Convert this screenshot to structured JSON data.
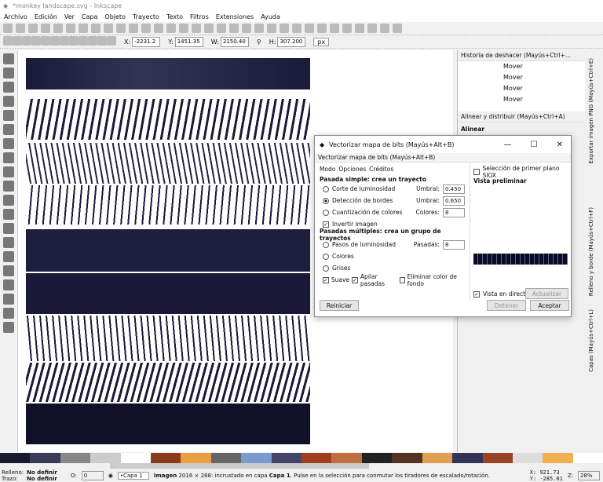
{
  "window": {
    "title": "*monkey landscape.svg - Inkscape"
  },
  "menu": [
    "Archivo",
    "Edición",
    "Ver",
    "Capa",
    "Objeto",
    "Trayecto",
    "Texto",
    "Filtros",
    "Extensiones",
    "Ayuda"
  ],
  "coords": {
    "x_label": "X:",
    "x": "-2231.2",
    "y_label": "Y:",
    "y": "1451.35",
    "w_label": "W:",
    "w": "2150.40",
    "h_label": "H:",
    "h": "307.200",
    "unit": "px"
  },
  "history": {
    "title": "Historia de deshacer (Mayús+Ctrl+...",
    "items": [
      "Mover",
      "Mover",
      "Mover",
      "Mover"
    ]
  },
  "align": {
    "title": "Alinear y distribuir (Mayús+Ctrl+A)",
    "section": "Alinear"
  },
  "vtabs": [
    "Exportar imagen PNG (Mayús+Ctrl+E)",
    "Relleno y borde (Mayús+Ctrl+F)",
    "Capas (Mayús+Ctrl+L)"
  ],
  "dialog": {
    "title": "Vectorizar mapa de bits (Mayús+Alt+B)",
    "subtitle": "Vectorizar mapa de bits (Mayús+Alt+B)",
    "tabs": [
      "Modo",
      "Opciones",
      "Créditos"
    ],
    "single_heading": "Pasada simple: crea un trayecto",
    "opt1": "Corte de luminosidad",
    "umbral1_label": "Umbral:",
    "umbral1": "0.450",
    "opt2": "Detección de bordes",
    "umbral2_label": "Umbral:",
    "umbral2": "0.650",
    "opt3": "Cuantización de colores",
    "colores_label": "Colores:",
    "colores": "8",
    "invert": "Invertir imagen",
    "multi_heading": "Pasadas múltiples: crea un grupo de trayectos",
    "m1": "Pasos de luminosidad",
    "pasadas_label": "Pasadas:",
    "pasadas": "8",
    "m2": "Colores",
    "m3": "Grises",
    "smooth": "Suave",
    "stack": "Apilar pasadas",
    "remove_bg": "Eliminar color de fondo",
    "siox": "Selección de primer plano SIOX",
    "preview": "Vista preliminar",
    "live": "Vista en directo",
    "update": "Actualizar",
    "reset": "Reiniciar",
    "stop": "Detener",
    "ok": "Aceptar"
  },
  "status": {
    "fill_label": "Relleno:",
    "fill": "No definir",
    "stroke_label": "Trazo:",
    "stroke": "No definir",
    "opacity_label": "O:",
    "opacity": "0",
    "layer": "•Capa 1",
    "msg_b1": "Imagen",
    "msg1": " 2016 × 288: incrustado en capa ",
    "msg_b2": "Capa 1",
    "msg2": ". Pulse en la selección para conmutar los tiradores de escalado/rotación.",
    "xr": "X: 921.73",
    "yr": "Y: -285.01",
    "zoom_label": "Z:",
    "zoom": "28%"
  },
  "palette": [
    "#1a1a2e",
    "#3a3a5a",
    "#888",
    "#ccc",
    "#fff",
    "#8b3a1a",
    "#e8a040",
    "#666",
    "#7a9ad0",
    "#444466",
    "#a04020",
    "#c07040",
    "#222",
    "#553322",
    "#e0a050",
    "#333355",
    "#994422",
    "#ddd",
    "#f0b050",
    "#ffffff"
  ]
}
